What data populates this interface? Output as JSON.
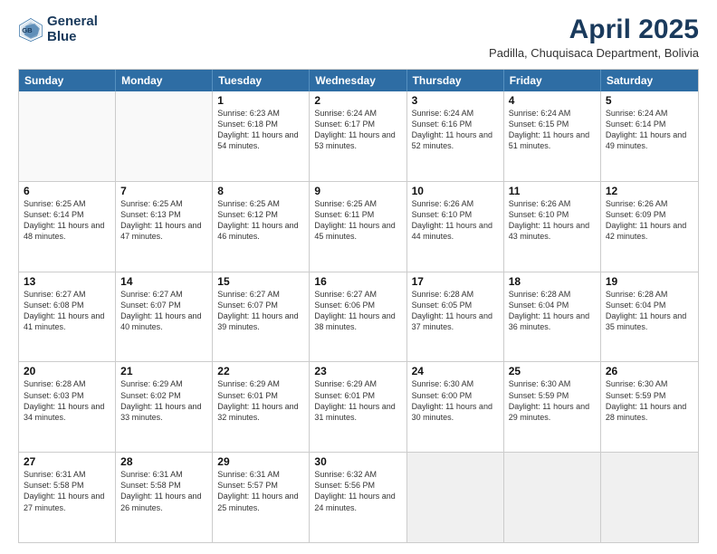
{
  "header": {
    "logo_line1": "General",
    "logo_line2": "Blue",
    "title": "April 2025",
    "subtitle": "Padilla, Chuquisaca Department, Bolivia"
  },
  "days": [
    "Sunday",
    "Monday",
    "Tuesday",
    "Wednesday",
    "Thursday",
    "Friday",
    "Saturday"
  ],
  "weeks": [
    [
      {
        "day": "",
        "info": ""
      },
      {
        "day": "",
        "info": ""
      },
      {
        "day": "1",
        "info": "Sunrise: 6:23 AM\nSunset: 6:18 PM\nDaylight: 11 hours and 54 minutes."
      },
      {
        "day": "2",
        "info": "Sunrise: 6:24 AM\nSunset: 6:17 PM\nDaylight: 11 hours and 53 minutes."
      },
      {
        "day": "3",
        "info": "Sunrise: 6:24 AM\nSunset: 6:16 PM\nDaylight: 11 hours and 52 minutes."
      },
      {
        "day": "4",
        "info": "Sunrise: 6:24 AM\nSunset: 6:15 PM\nDaylight: 11 hours and 51 minutes."
      },
      {
        "day": "5",
        "info": "Sunrise: 6:24 AM\nSunset: 6:14 PM\nDaylight: 11 hours and 49 minutes."
      }
    ],
    [
      {
        "day": "6",
        "info": "Sunrise: 6:25 AM\nSunset: 6:14 PM\nDaylight: 11 hours and 48 minutes."
      },
      {
        "day": "7",
        "info": "Sunrise: 6:25 AM\nSunset: 6:13 PM\nDaylight: 11 hours and 47 minutes."
      },
      {
        "day": "8",
        "info": "Sunrise: 6:25 AM\nSunset: 6:12 PM\nDaylight: 11 hours and 46 minutes."
      },
      {
        "day": "9",
        "info": "Sunrise: 6:25 AM\nSunset: 6:11 PM\nDaylight: 11 hours and 45 minutes."
      },
      {
        "day": "10",
        "info": "Sunrise: 6:26 AM\nSunset: 6:10 PM\nDaylight: 11 hours and 44 minutes."
      },
      {
        "day": "11",
        "info": "Sunrise: 6:26 AM\nSunset: 6:10 PM\nDaylight: 11 hours and 43 minutes."
      },
      {
        "day": "12",
        "info": "Sunrise: 6:26 AM\nSunset: 6:09 PM\nDaylight: 11 hours and 42 minutes."
      }
    ],
    [
      {
        "day": "13",
        "info": "Sunrise: 6:27 AM\nSunset: 6:08 PM\nDaylight: 11 hours and 41 minutes."
      },
      {
        "day": "14",
        "info": "Sunrise: 6:27 AM\nSunset: 6:07 PM\nDaylight: 11 hours and 40 minutes."
      },
      {
        "day": "15",
        "info": "Sunrise: 6:27 AM\nSunset: 6:07 PM\nDaylight: 11 hours and 39 minutes."
      },
      {
        "day": "16",
        "info": "Sunrise: 6:27 AM\nSunset: 6:06 PM\nDaylight: 11 hours and 38 minutes."
      },
      {
        "day": "17",
        "info": "Sunrise: 6:28 AM\nSunset: 6:05 PM\nDaylight: 11 hours and 37 minutes."
      },
      {
        "day": "18",
        "info": "Sunrise: 6:28 AM\nSunset: 6:04 PM\nDaylight: 11 hours and 36 minutes."
      },
      {
        "day": "19",
        "info": "Sunrise: 6:28 AM\nSunset: 6:04 PM\nDaylight: 11 hours and 35 minutes."
      }
    ],
    [
      {
        "day": "20",
        "info": "Sunrise: 6:28 AM\nSunset: 6:03 PM\nDaylight: 11 hours and 34 minutes."
      },
      {
        "day": "21",
        "info": "Sunrise: 6:29 AM\nSunset: 6:02 PM\nDaylight: 11 hours and 33 minutes."
      },
      {
        "day": "22",
        "info": "Sunrise: 6:29 AM\nSunset: 6:01 PM\nDaylight: 11 hours and 32 minutes."
      },
      {
        "day": "23",
        "info": "Sunrise: 6:29 AM\nSunset: 6:01 PM\nDaylight: 11 hours and 31 minutes."
      },
      {
        "day": "24",
        "info": "Sunrise: 6:30 AM\nSunset: 6:00 PM\nDaylight: 11 hours and 30 minutes."
      },
      {
        "day": "25",
        "info": "Sunrise: 6:30 AM\nSunset: 5:59 PM\nDaylight: 11 hours and 29 minutes."
      },
      {
        "day": "26",
        "info": "Sunrise: 6:30 AM\nSunset: 5:59 PM\nDaylight: 11 hours and 28 minutes."
      }
    ],
    [
      {
        "day": "27",
        "info": "Sunrise: 6:31 AM\nSunset: 5:58 PM\nDaylight: 11 hours and 27 minutes."
      },
      {
        "day": "28",
        "info": "Sunrise: 6:31 AM\nSunset: 5:58 PM\nDaylight: 11 hours and 26 minutes."
      },
      {
        "day": "29",
        "info": "Sunrise: 6:31 AM\nSunset: 5:57 PM\nDaylight: 11 hours and 25 minutes."
      },
      {
        "day": "30",
        "info": "Sunrise: 6:32 AM\nSunset: 5:56 PM\nDaylight: 11 hours and 24 minutes."
      },
      {
        "day": "",
        "info": ""
      },
      {
        "day": "",
        "info": ""
      },
      {
        "day": "",
        "info": ""
      }
    ]
  ]
}
